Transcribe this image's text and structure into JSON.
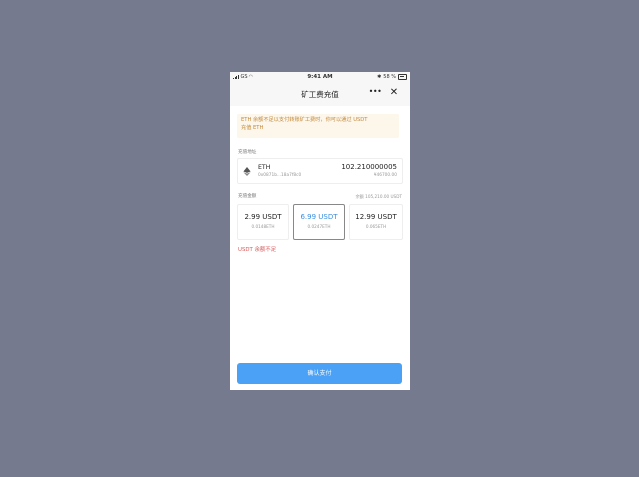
{
  "status_bar": {
    "carrier": "GS",
    "time": "9:41 AM",
    "right_text": "58 %"
  },
  "nav": {
    "title": "矿工费充值",
    "more_icon": "more-horizontal-icon",
    "close_icon": "close-icon"
  },
  "notice": {
    "line1": "ETH 余额不足以支付转账矿工费时，你可以通过 USDT",
    "line2": "充值 ETH",
    "bg_color": "#fdf6ea",
    "text_color": "#c28a3c"
  },
  "account": {
    "section_label": "充值地址",
    "token": "ETH",
    "address": "0x0871b...18a7f8c0",
    "balance": "102.210000005",
    "fiat": "¥46700.00",
    "icon": "ethereum-icon"
  },
  "amount": {
    "section_label": "充值金额",
    "balance_hint": "余额 105,210.00 USDT",
    "options": [
      {
        "price": "2.99 USDT",
        "eth": "0.0148ETH",
        "selected": false
      },
      {
        "price": "6.99 USDT",
        "eth": "0.0247ETH",
        "selected": true
      },
      {
        "price": "12.99 USDT",
        "eth": "0.065ETH",
        "selected": false
      }
    ]
  },
  "error": "USDT 余额不足",
  "confirm_label": "确认支付",
  "colors": {
    "accent": "#4aa1f5",
    "selected_text": "#3a8fe0",
    "error": "#d95b5b",
    "backdrop": "#767a8f"
  }
}
